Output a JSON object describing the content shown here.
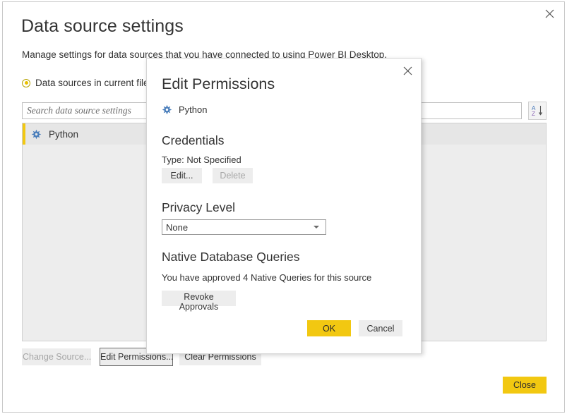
{
  "window": {
    "title": "Data source settings",
    "subtitle": "Manage settings for data sources that you have connected to using Power BI Desktop.",
    "close_icon": "close-icon"
  },
  "scope": {
    "selected_option_label": "Data sources in current file"
  },
  "search": {
    "value": "",
    "placeholder": "Search data source settings"
  },
  "sort": {
    "icon": "sort-az-icon",
    "top_letter": "A",
    "bottom_letter": "Z"
  },
  "source_list": {
    "items": [
      {
        "label": "Python",
        "icon": "python-source-icon",
        "selected": true
      }
    ]
  },
  "footer": {
    "change_source_label": "Change Source...",
    "edit_permissions_label": "Edit Permissions...",
    "clear_permissions_label": "Clear Permissions",
    "close_label": "Close"
  },
  "modal": {
    "title": "Edit Permissions",
    "close_icon": "close-icon",
    "source": {
      "label": "Python",
      "icon": "python-source-icon"
    },
    "credentials": {
      "heading": "Credentials",
      "type_text": "Type: Not Specified",
      "edit_label": "Edit...",
      "delete_label": "Delete"
    },
    "privacy": {
      "heading": "Privacy Level",
      "selected_value": "None",
      "caret_icon": "chevron-down-icon"
    },
    "native_queries": {
      "heading": "Native Database Queries",
      "status_text": "You have approved 4 Native Queries for this source",
      "revoke_label": "Revoke Approvals"
    },
    "ok_label": "OK",
    "cancel_label": "Cancel"
  },
  "colors": {
    "accent_yellow": "#f2c811",
    "button_gray": "#ededed",
    "text": "#333333",
    "disabled_text": "#a6a6a6",
    "python_icon_blue": "#4a7ebb"
  }
}
